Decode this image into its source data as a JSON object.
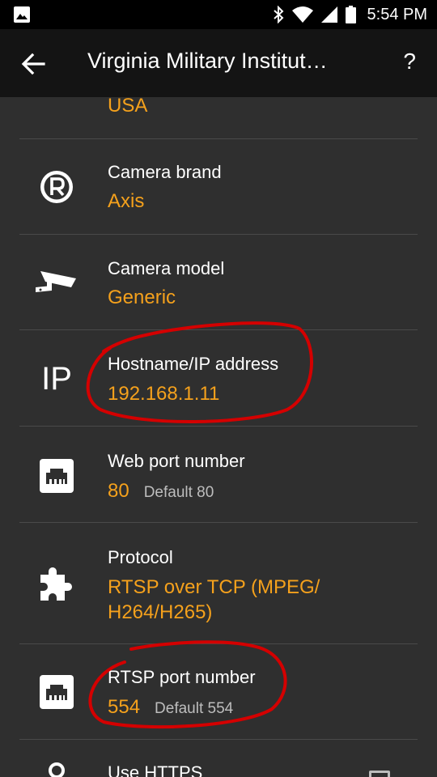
{
  "status_bar": {
    "time": "5:54 PM",
    "icons": [
      "image-icon",
      "bluetooth-icon",
      "wifi-icon",
      "signal-icon",
      "battery-icon"
    ]
  },
  "toolbar": {
    "title": "Virginia Military Institut…",
    "back_icon": "arrow-back-icon",
    "help_label": "?"
  },
  "settings": {
    "country_value": "USA",
    "items": [
      {
        "icon": "registered-icon",
        "label": "Camera brand",
        "value": "Axis"
      },
      {
        "icon": "camera-icon",
        "label": "Camera model",
        "value": "Generic"
      },
      {
        "icon": "ip-icon",
        "icon_text": "IP",
        "label": "Hostname/IP address",
        "value": "192.168.1.11"
      },
      {
        "icon": "ethernet-icon",
        "label": "Web port number",
        "value": "80",
        "default": "Default 80"
      },
      {
        "icon": "puzzle-icon",
        "label": "Protocol",
        "value_line1": "RTSP over TCP (MPEG/",
        "value_line2": "H264/H265)"
      },
      {
        "icon": "ethernet-icon",
        "label": "RTSP port number",
        "value": "554",
        "default": "Default 554"
      },
      {
        "icon": "lock-icon",
        "label": "Use HTTPS"
      }
    ]
  },
  "colors": {
    "accent": "#f5a11c",
    "background": "#2f2f2f",
    "toolbar": "#141414",
    "annotation": "#d40000"
  }
}
